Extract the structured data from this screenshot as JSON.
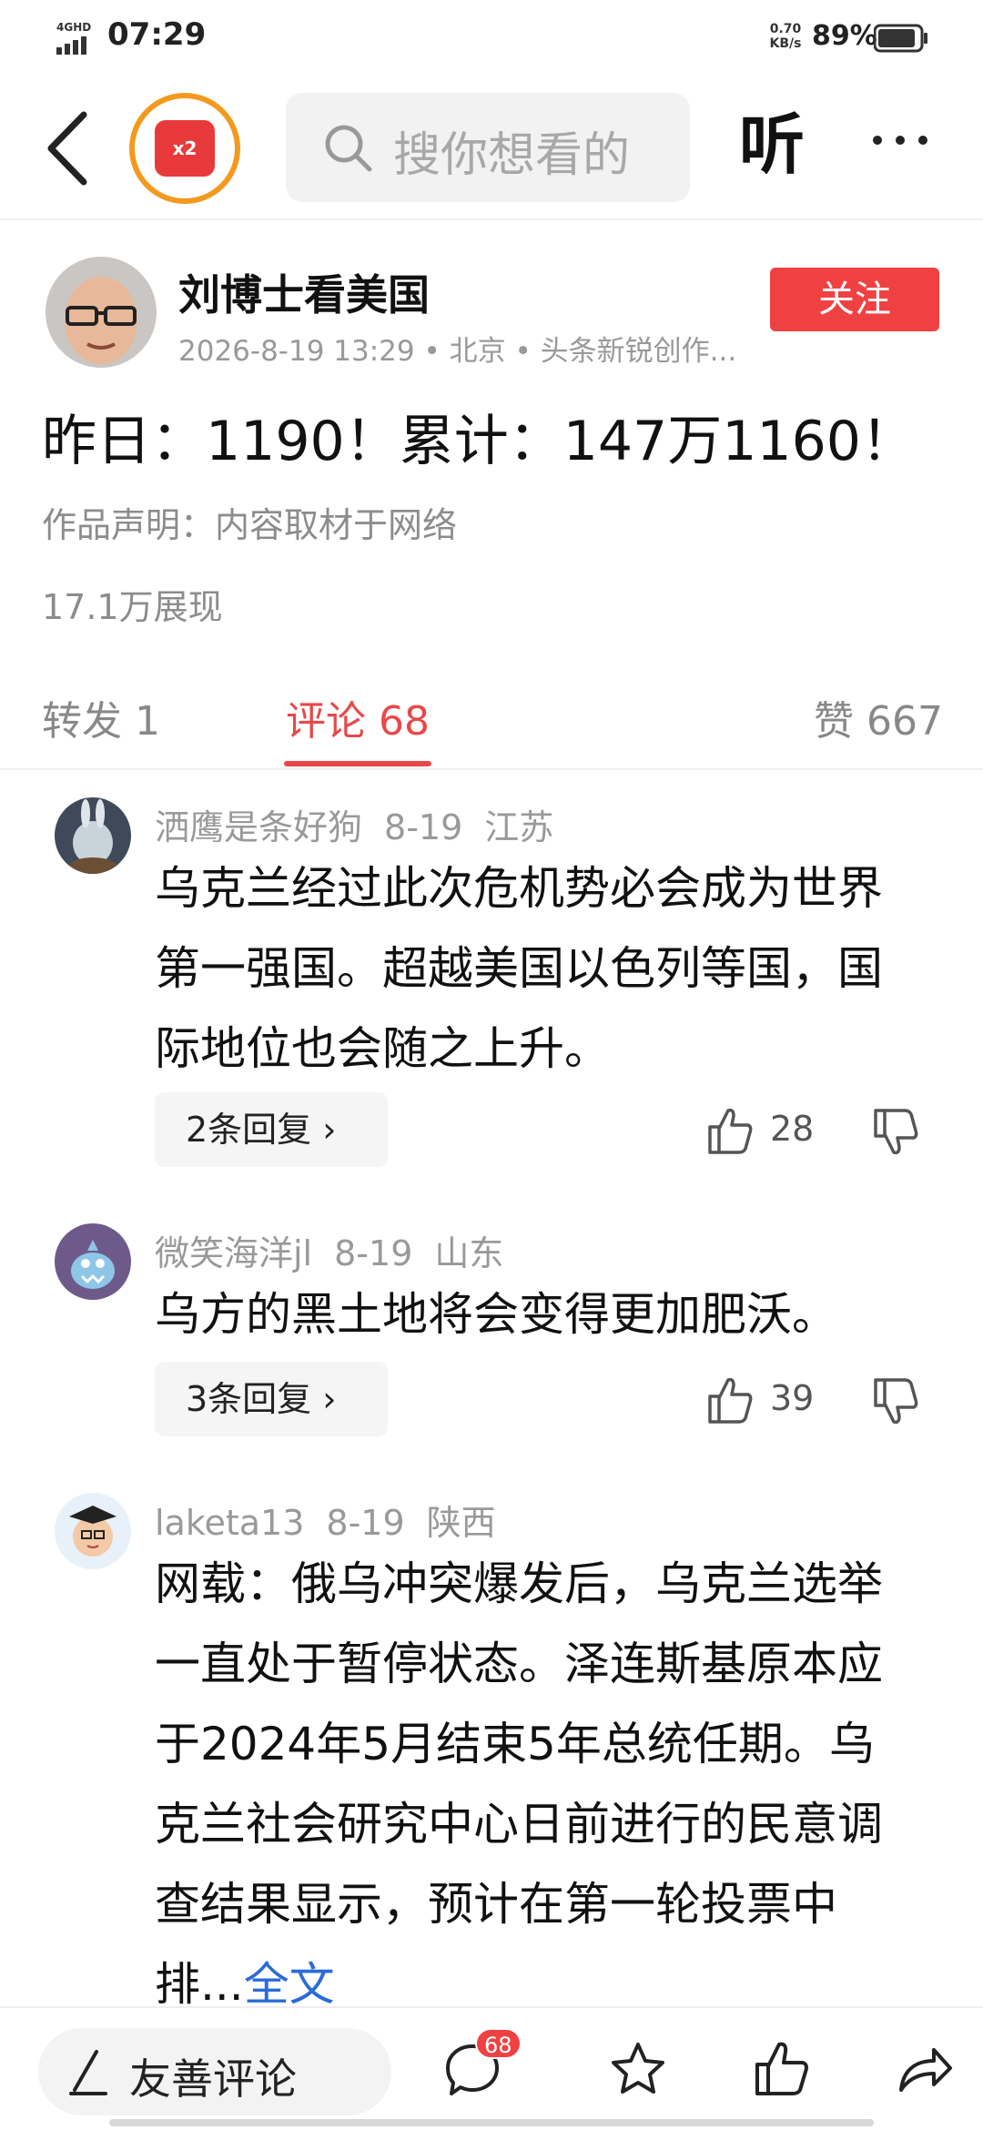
{
  "status_bar": {
    "network": "4GHD",
    "time": "07:29",
    "speed_value": "0.70",
    "speed_unit": "KB/s",
    "battery_percent": "89%"
  },
  "nav": {
    "redpacket_label": "x2",
    "search_placeholder": "搜你想看的",
    "listen_label": "听"
  },
  "author": {
    "name": "刘博士看美国",
    "meta": "2026-8-19 13:29 • 北京 • 头条新锐创作...",
    "follow_label": "关注"
  },
  "post": {
    "title": "昨日：1190！累计：147万1160！",
    "statement": "作品声明：内容取材于网络",
    "views": "17.1万展现"
  },
  "tabs": {
    "forward": "转发 1",
    "comments": "评论 68",
    "likes": "赞 667"
  },
  "comments": [
    {
      "user": "洒鹰是条好狗",
      "date": "8-19",
      "location": "江苏",
      "text": "乌克兰经过此次危机势必会成为世界第一强国。超越美国以色列等国，国际地位也会随之上升。",
      "replies": "2条回复 ›",
      "likes": "28"
    },
    {
      "user": "微笑海洋jl",
      "date": "8-19",
      "location": "山东",
      "text": "乌方的黑土地将会变得更加肥沃。",
      "replies": "3条回复 ›",
      "likes": "39"
    },
    {
      "user": "laketa13",
      "date": "8-19",
      "location": "陕西",
      "text": "网载：俄乌冲突爆发后，乌克兰选举一直处于暂停状态。泽连斯基原本应于2024年5月结束5年总统任期。乌克兰社会研究中心日前进行的民意调查结果显示，预计在第一轮投票中排...",
      "full_text_link": "全文"
    }
  ],
  "bottom_bar": {
    "input_placeholder": "友善评论",
    "comment_badge": "68"
  },
  "icons": [
    "signal-icon",
    "back-icon",
    "redpacket-icon",
    "search-icon",
    "more-icon",
    "thumbs-up-icon",
    "thumbs-down-icon",
    "pen-icon",
    "comment-bubble-icon",
    "star-icon",
    "share-icon",
    "battery-icon"
  ],
  "colors": {
    "accent_red": "#f04142",
    "tab_active": "#e8484a",
    "link_blue": "#2a6bd6",
    "ring_orange": "#f39a1e"
  }
}
